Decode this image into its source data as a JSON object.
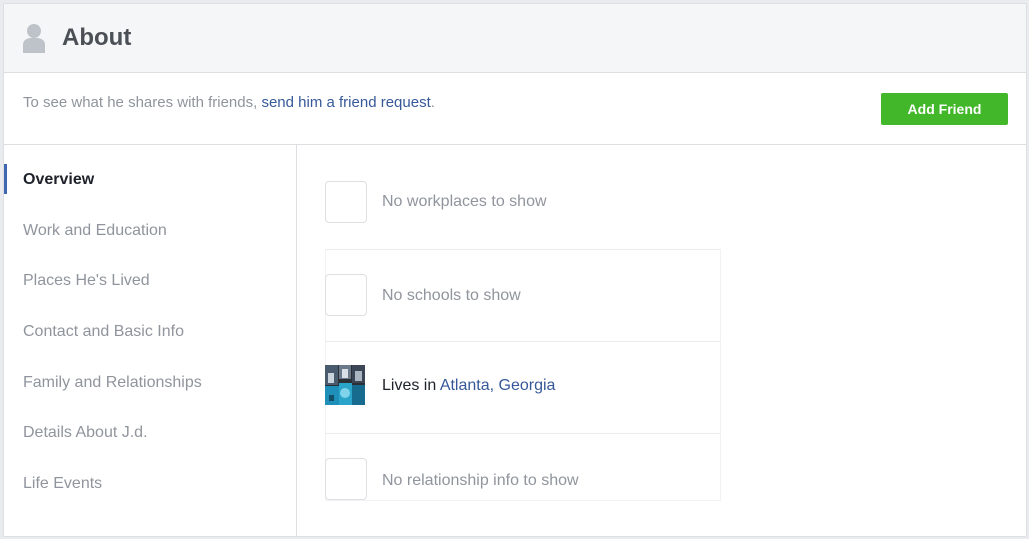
{
  "header": {
    "title": "About",
    "icon": "person-silhouette-icon"
  },
  "notice": {
    "prefix": "To see what he shares with friends, ",
    "link": "send him a friend request",
    "suffix": "."
  },
  "actions": {
    "add_friend": "Add Friend"
  },
  "sidebar": {
    "items": [
      {
        "label": "Overview",
        "active": true
      },
      {
        "label": "Work and Education"
      },
      {
        "label": "Places He's Lived"
      },
      {
        "label": "Contact and Basic Info"
      },
      {
        "label": "Family and Relationships"
      },
      {
        "label": "Details About J.d."
      },
      {
        "label": "Life Events"
      }
    ]
  },
  "overview": {
    "workplaces": "No workplaces to show",
    "schools": "No schools to show",
    "lives_prefix": "Lives in ",
    "city": "Atlanta",
    "comma": ", ",
    "state": "Georgia",
    "relationship": "No relationship info to show"
  },
  "colors": {
    "accent": "#4267b2",
    "link": "#365899",
    "button_green": "#42b72a",
    "muted_text": "#90949c"
  }
}
